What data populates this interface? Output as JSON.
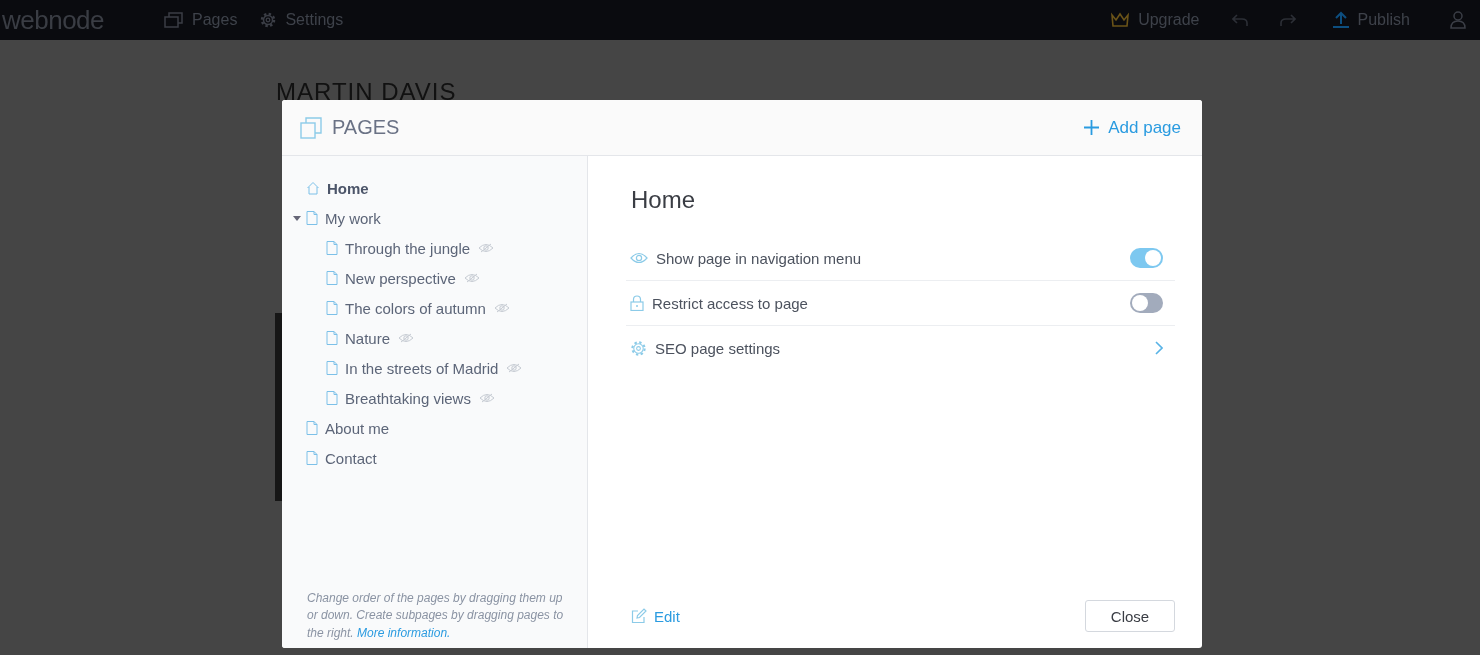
{
  "topbar": {
    "logo": "webnode",
    "nav": [
      {
        "label": "Pages"
      },
      {
        "label": "Settings"
      }
    ],
    "upgrade": "Upgrade",
    "publish": "Publish"
  },
  "background": {
    "heading": "MARTIN DAVIS"
  },
  "dialog": {
    "title": "PAGES",
    "add_page": "Add page",
    "tree": [
      {
        "label": "Home",
        "kind": "home",
        "selected": true,
        "hidden_in_menu": false
      },
      {
        "label": "My work",
        "kind": "page",
        "selected": false,
        "hidden_in_menu": false,
        "expanded": true,
        "children": [
          {
            "label": "Through the jungle",
            "kind": "page",
            "selected": false,
            "hidden_in_menu": true
          },
          {
            "label": "New perspective",
            "kind": "page",
            "selected": false,
            "hidden_in_menu": true
          },
          {
            "label": "The colors of autumn",
            "kind": "page",
            "selected": false,
            "hidden_in_menu": true
          },
          {
            "label": "Nature",
            "kind": "page",
            "selected": false,
            "hidden_in_menu": true
          },
          {
            "label": "In the streets of Madrid",
            "kind": "page",
            "selected": false,
            "hidden_in_menu": true
          },
          {
            "label": "Breathtaking views",
            "kind": "page",
            "selected": false,
            "hidden_in_menu": true
          }
        ]
      },
      {
        "label": "About me",
        "kind": "page",
        "selected": false,
        "hidden_in_menu": false
      },
      {
        "label": "Contact",
        "kind": "page",
        "selected": false,
        "hidden_in_menu": false
      }
    ],
    "hint": "Change order of the pages by dragging them up or down. Create subpages by dragging pages to the right.",
    "hint_link": "More information.",
    "page_title": "Home",
    "settings": [
      {
        "label": "Show page in navigation menu",
        "kind": "toggle",
        "on": true
      },
      {
        "label": "Restrict access to page",
        "kind": "toggle",
        "on": false
      },
      {
        "label": "SEO page settings",
        "kind": "link"
      }
    ],
    "edit": "Edit",
    "close": "Close"
  }
}
